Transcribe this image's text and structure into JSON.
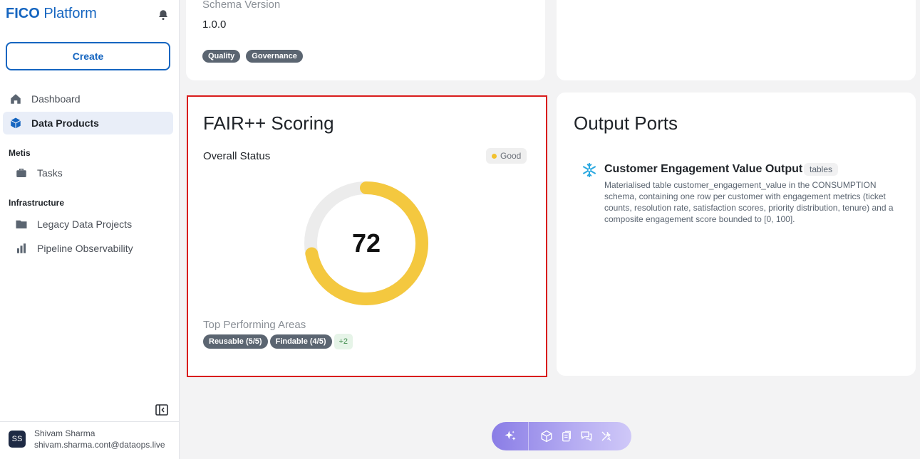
{
  "brand": {
    "bold": "FICO",
    "rest": " Platform"
  },
  "sidebar": {
    "create_label": "Create",
    "nav": [
      {
        "label": "Dashboard",
        "icon": "home-icon"
      },
      {
        "label": "Data Products",
        "icon": "cube-icon",
        "active": true
      }
    ],
    "sections": [
      {
        "title": "Metis",
        "items": [
          {
            "label": "Tasks",
            "icon": "briefcase-icon"
          }
        ]
      },
      {
        "title": "Infrastructure",
        "items": [
          {
            "label": "Legacy Data Projects",
            "icon": "folder-icon"
          },
          {
            "label": "Pipeline Observability",
            "icon": "bar-chart-icon"
          }
        ]
      }
    ]
  },
  "user": {
    "initials": "SS",
    "name": "Shivam Sharma",
    "email": "shivam.sharma.cont@dataops.live"
  },
  "schema": {
    "label": "Schema Version",
    "value": "1.0.0",
    "tags": [
      "Quality",
      "Governance"
    ]
  },
  "fair": {
    "title": "FAIR++ Scoring",
    "overall_label": "Overall Status",
    "status": "Good",
    "score": "72",
    "score_fraction": 0.72,
    "top_label": "Top Performing Areas",
    "areas": [
      "Reusable (5/5)",
      "Findable (4/5)"
    ],
    "more": "+2",
    "colors": {
      "ring": "#f4c83f",
      "track": "#ececec"
    }
  },
  "output": {
    "title": "Output Ports",
    "port_name": "Customer Engagement Value Output",
    "port_type": "tables",
    "port_desc": "Materialised table customer_engagement_value in the CONSUMPTION schema, containing one row per customer with engagement metrics (ticket counts, resolution rate, satisfaction scores, priority distribution, tenure) and a composite engagement score bounded to [0, 100]."
  }
}
